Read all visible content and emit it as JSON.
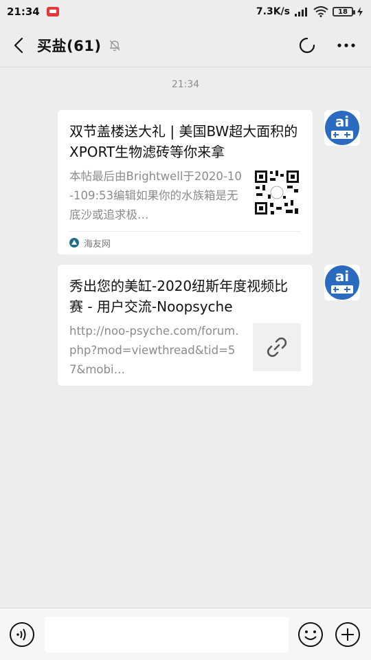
{
  "status_bar": {
    "time": "21:34",
    "network_speed": "7.3K/s",
    "battery_level": "18"
  },
  "header": {
    "title": "买盐(61)"
  },
  "chat": {
    "timestamp": "21:34",
    "messages": [
      {
        "title": "双节盖楼送大礼 | 美国BW超大面积的XPORT生物滤砖等你来拿",
        "description": "本帖最后由Brightwell于2020-10-109:53编辑如果你的水族箱是无底沙或追求极…",
        "source": "海友网",
        "thumbnail_icon": "qr-code-icon"
      },
      {
        "title": "秀出您的美缸-2020纽斯年度视频比赛 - 用户交流-Noopsyche",
        "description": "http://noo-psyche.com/forum.php?mod=viewthread&tid=57&mobi…",
        "thumbnail_icon": "link-icon"
      }
    ]
  },
  "input_bar": {
    "placeholder": ""
  },
  "colors": {
    "background": "#ededed",
    "card": "#ffffff",
    "avatar_blue": "#2a6bbf"
  }
}
